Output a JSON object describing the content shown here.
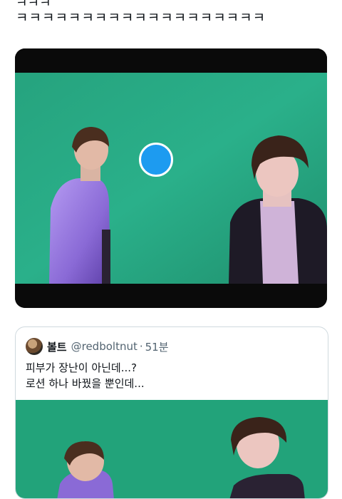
{
  "tweet": {
    "text_cut": "ㅋㅋㅋ",
    "text": "ㅋㅋㅋㅋㅋㅋㅋㅋㅋㅋㅋㅋㅋㅋㅋㅋㅋㅋㅋ"
  },
  "quote": {
    "name": "볼트",
    "handle": "@redboltnut",
    "separator": "·",
    "time": "51분",
    "line1": "피부가 장난이 아닌데...?",
    "line2": "로션 하나 바꿨을 뿐인데..."
  },
  "colors": {
    "accent": "#1d9bf0",
    "background_green": "#22a37a",
    "text": "#0f1419",
    "muted": "#536471"
  }
}
